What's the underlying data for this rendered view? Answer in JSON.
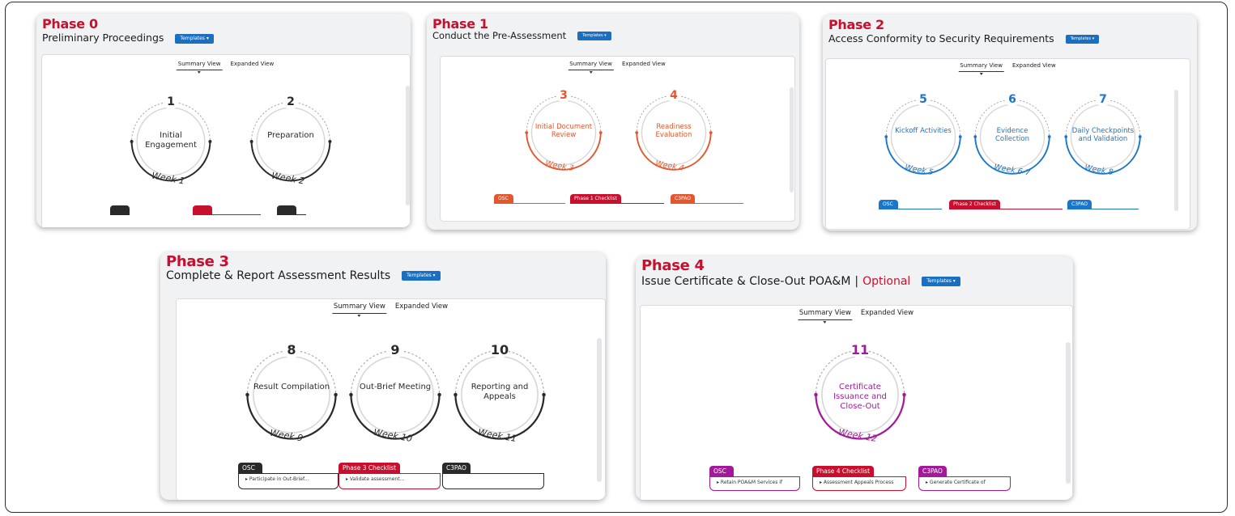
{
  "colors": {
    "red": "#c8102e",
    "orange": "#e4572e",
    "blue": "#1b75c8",
    "purple": "#a21a9a",
    "dark": "#2a2a2a",
    "button": "#1b6fc1"
  },
  "view_tabs": {
    "summary": "Summary View",
    "expanded": "Expanded View"
  },
  "phases": [
    {
      "title": "Phase 0",
      "subtitle": "Preliminary Proceedings",
      "button": "Templates ▾",
      "steps": [
        {
          "num": "1",
          "label": "Initial Engagement",
          "week": "Week 1"
        },
        {
          "num": "2",
          "label": "Preparation",
          "week": "Week 2"
        }
      ],
      "tabs": [
        {
          "label": ""
        },
        {
          "label": ""
        },
        {
          "label": ""
        }
      ]
    },
    {
      "title": "Phase 1",
      "subtitle": "Conduct the Pre-Assessment",
      "button": "Templates ▾",
      "steps": [
        {
          "num": "3",
          "label": "Initial Document Review",
          "week": "Week 3"
        },
        {
          "num": "4",
          "label": "Readiness Evaluation",
          "week": "Week 4"
        }
      ],
      "tabs": [
        {
          "label": "OSC"
        },
        {
          "label": "Phase 1 Checklist"
        },
        {
          "label": "C3PAO"
        }
      ]
    },
    {
      "title": "Phase 2",
      "subtitle": "Access Conformity to Security Requirements",
      "button": "Templates ▾",
      "steps": [
        {
          "num": "5",
          "label": "Kickoff Activities",
          "week": "Week 5"
        },
        {
          "num": "6",
          "label": "Evidence Collection",
          "week": "Week 6-7"
        },
        {
          "num": "7",
          "label": "Daily Checkpoints and Validation",
          "week": "Week 8"
        }
      ],
      "tabs": [
        {
          "label": "OSC"
        },
        {
          "label": "Phase 2 Checklist"
        },
        {
          "label": "C3PAO"
        }
      ]
    },
    {
      "title": "Phase 3",
      "subtitle": "Complete & Report Assessment Results",
      "button": "Templates ▾",
      "steps": [
        {
          "num": "8",
          "label": "Result Compilation",
          "week": "Week 9"
        },
        {
          "num": "9",
          "label": "Out-Brief Meeting",
          "week": "Week 10"
        },
        {
          "num": "10",
          "label": "Reporting and Appeals",
          "week": "Week 11"
        }
      ],
      "tabs": [
        {
          "label": "OSC",
          "text": "▸ Participate in Out-Brief..."
        },
        {
          "label": "Phase 3 Checklist",
          "text": "▸ Validate assessment..."
        },
        {
          "label": "C3PAO",
          "text": ""
        }
      ]
    },
    {
      "title": "Phase 4",
      "subtitle": "Issue Certificate & Close-Out POA&M",
      "subtitle_sep": "|",
      "subtitle_optional": "Optional",
      "button": "Templates ▾",
      "steps": [
        {
          "num": "11",
          "label": "Certificate Issuance and Close-Out",
          "week": "Week 12"
        }
      ],
      "tabs": [
        {
          "label": "OSC",
          "text": "▸ Retain POA&M Services if"
        },
        {
          "label": "Phase 4 Checklist",
          "text": "▸ Assessment Appeals Process"
        },
        {
          "label": "C3PAO",
          "text": "▸ Generate Certificate of"
        }
      ]
    }
  ]
}
